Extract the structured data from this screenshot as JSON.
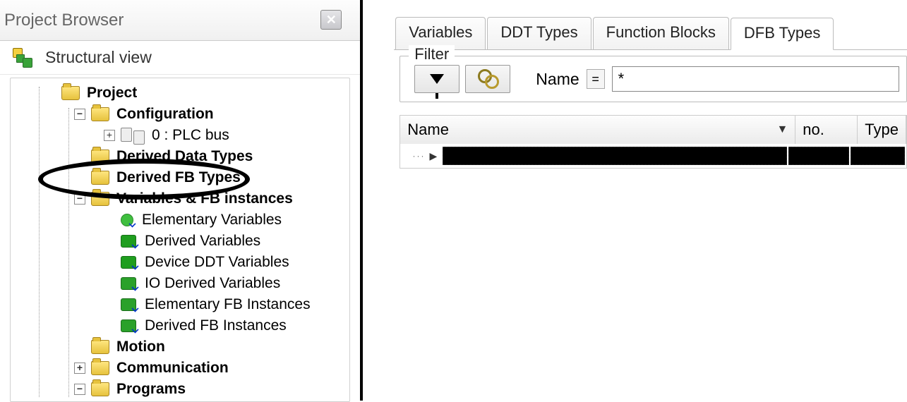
{
  "window": {
    "title": "Project Browser"
  },
  "structural": {
    "title": "Structural view"
  },
  "tree": {
    "project": "Project",
    "configuration": "Configuration",
    "plc_bus": "0 : PLC bus",
    "derived_data_types": "Derived Data Types",
    "derived_fb_types": "Derived FB Types",
    "variables_fb": "Variables & FB instances",
    "elem_vars": "Elementary Variables",
    "derived_vars": "Derived Variables",
    "device_ddt": "Device DDT Variables",
    "io_derived": "IO Derived Variables",
    "elem_fb_inst": "Elementary FB Instances",
    "derived_fb_inst": "Derived FB Instances",
    "motion": "Motion",
    "communication": "Communication",
    "programs": "Programs"
  },
  "tabs": {
    "variables": "Variables",
    "ddt": "DDT Types",
    "fb": "Function Blocks",
    "dfb": "DFB Types"
  },
  "filter": {
    "legend": "Filter",
    "name_label": "Name",
    "eq": "=",
    "name_value": "*"
  },
  "grid": {
    "col_name": "Name",
    "col_no": "no.",
    "col_type": "Type"
  }
}
